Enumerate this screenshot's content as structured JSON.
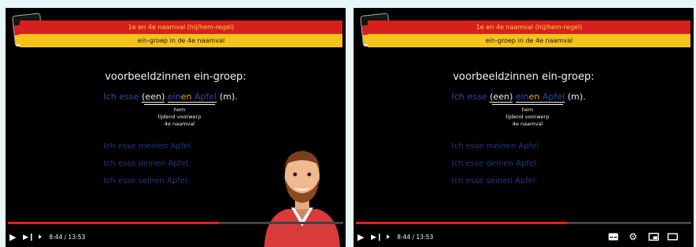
{
  "players": [
    {
      "banner_title": "1e en 4e naamval (hij/hem-regel)",
      "banner_subtitle": "ein-groep in de 4e naamval",
      "heading": "voorbeeldzinnen ein-groep:",
      "sentence": {
        "ich": "Ich esse",
        "article": "(een)",
        "ein": "ein",
        "ending": "en",
        "noun": "Apfel",
        "gender": "(m)."
      },
      "gloss": [
        "hem",
        "lijdend voorwerp",
        "4e naamval"
      ],
      "examples": [
        "Ich esse meinen Apfel.",
        "Ich esse deinen Apfel.",
        "Ich esse seinen Apfel."
      ],
      "time": "8:44 / 13:53",
      "progress": 0.63
    },
    {
      "banner_title": "1e en 4e naamval (hij/hem-regel)",
      "banner_subtitle": "ein-groep in de 4e naamval",
      "heading": "voorbeeldzinnen ein-groep:",
      "sentence": {
        "ich": "Ich esse",
        "article": "(een)",
        "ein": "ein",
        "ending": "en",
        "noun": "Apfel",
        "gender": "(m)."
      },
      "gloss": [
        "hem",
        "lijdend voorwerp",
        "4e naamval"
      ],
      "examples": [
        "Ich esse meinen Apfel.",
        "Ich esse deinen Apfel.",
        "Ich esse seinen Apfel."
      ],
      "time": "8:44 / 13:53",
      "progress": 0.63
    }
  ],
  "colors": {
    "red": "#d81f1f",
    "yellow": "#f6c21b",
    "blue": "#2a4da8",
    "orange": "#e8a41e"
  },
  "icons": [
    "play-icon",
    "next-icon",
    "volume-icon",
    "subtitles-icon",
    "gear-icon",
    "miniplayer-icon",
    "theater-icon"
  ]
}
